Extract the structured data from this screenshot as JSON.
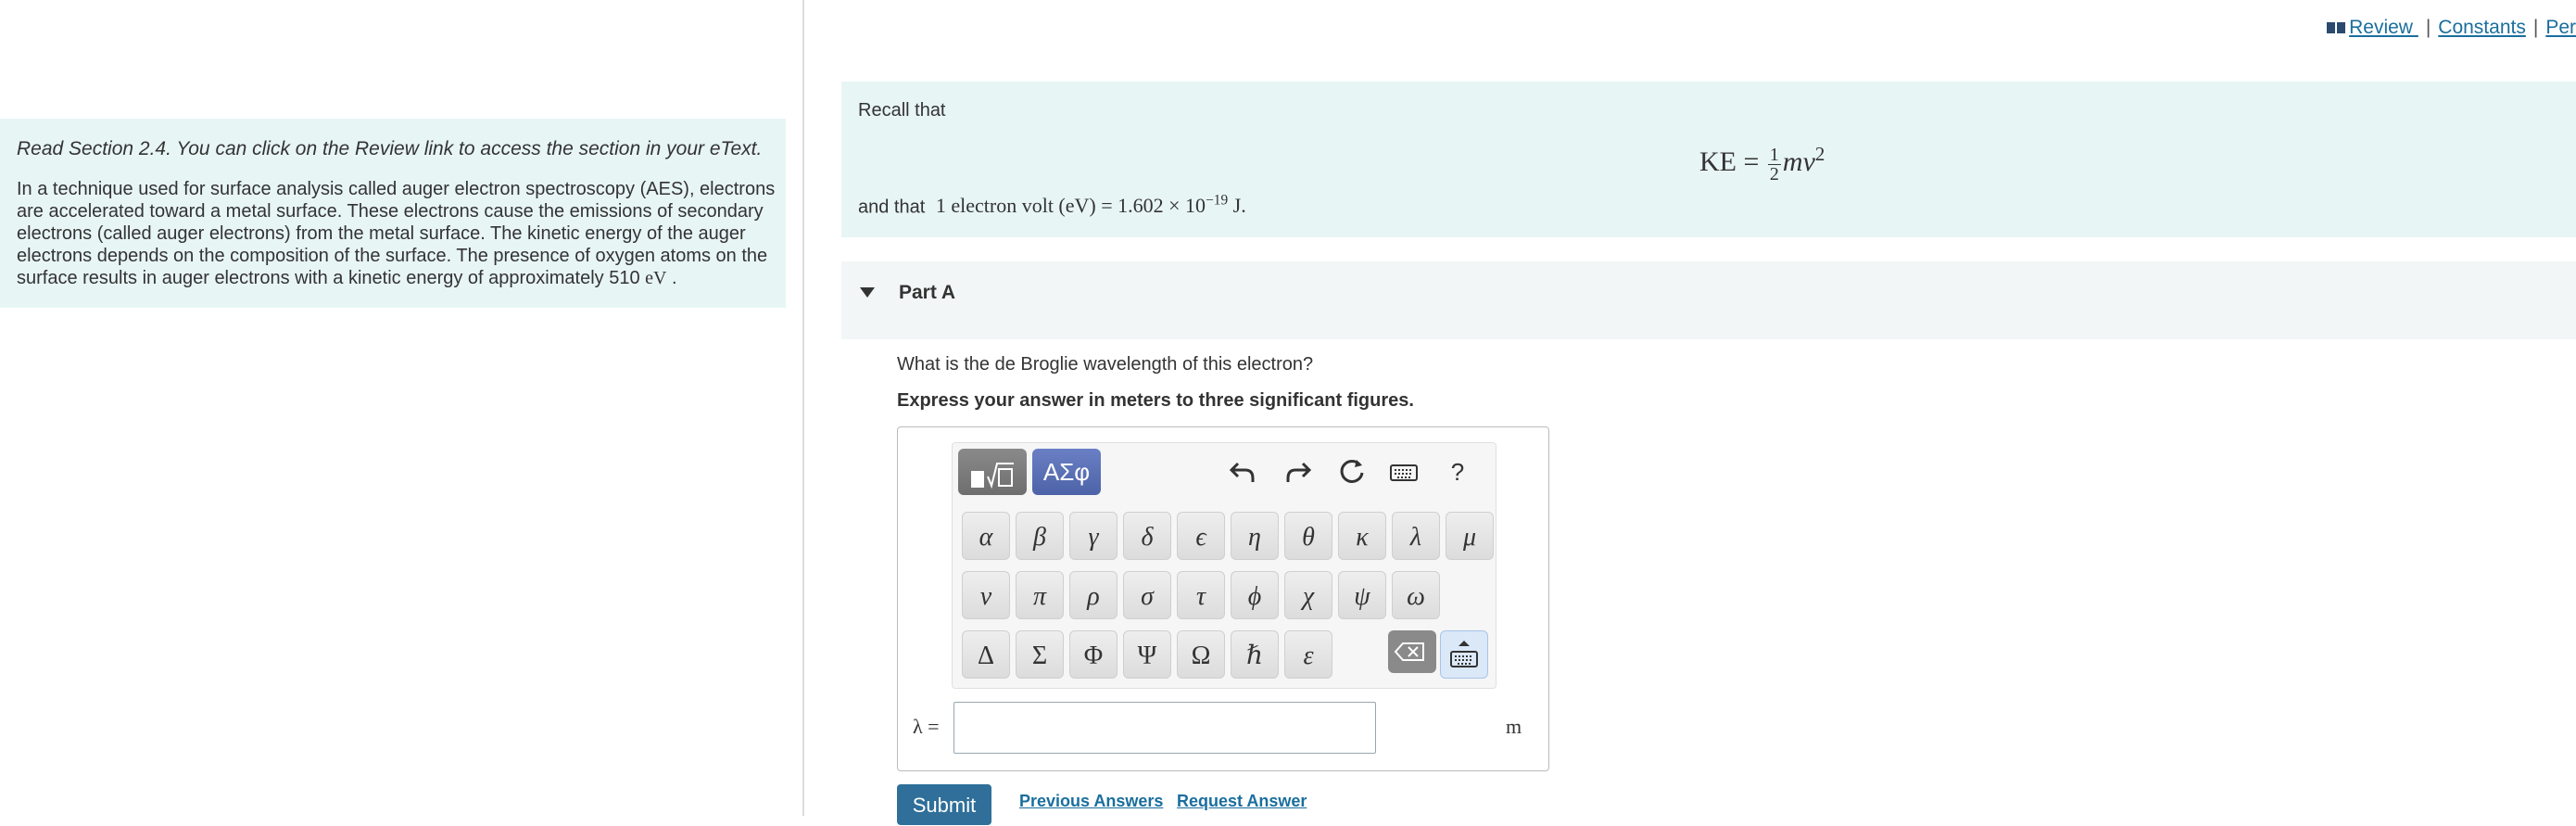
{
  "top_links": {
    "review": "Review",
    "constants": "Constants",
    "periodic": "Per",
    "separator": "|"
  },
  "intro": {
    "instruction": "Read Section 2.4. You can click on the Review link to access the section in your eText.",
    "problem_text": "In a technique used for surface analysis called auger electron spectroscopy (AES), electrons are accelerated toward a metal surface. These electrons cause the emissions of secondary electrons (called auger electrons) from the metal surface. The kinetic energy of the auger electrons depends on the composition of the surface. The presence of oxygen atoms on the surface results in auger electrons with a kinetic energy of approximately 510",
    "energy_unit": "eV",
    "period": "."
  },
  "recall": {
    "label": "Recall that",
    "ke_lhs": "KE =",
    "ke_num": "1",
    "ke_den": "2",
    "ke_rhs": "mv",
    "ke_exp": "2",
    "and_that": "and that",
    "ev_text": "1 electron volt (eV) = 1.602 × 10",
    "ev_exp": "−19",
    "ev_unit": "J."
  },
  "part": {
    "label": "Part A"
  },
  "question": "What is the de Broglie wavelength of this electron?",
  "instruction": "Express your answer in meters to three significant figures.",
  "palette": {
    "symbols_label": "ΑΣφ",
    "help": "?",
    "row1": [
      "α",
      "β",
      "γ",
      "δ",
      "ϵ",
      "η",
      "θ",
      "κ",
      "λ",
      "μ"
    ],
    "row2": [
      "ν",
      "π",
      "ρ",
      "σ",
      "τ",
      "ϕ",
      "χ",
      "ψ",
      "ω"
    ],
    "row3": [
      "Δ",
      "Σ",
      "Φ",
      "Ψ",
      "Ω",
      "ℏ",
      "ε"
    ]
  },
  "answer": {
    "variable": "λ =",
    "value": "",
    "unit": "m"
  },
  "actions": {
    "submit": "Submit",
    "previous": "Previous Answers",
    "request": "Request Answer"
  }
}
